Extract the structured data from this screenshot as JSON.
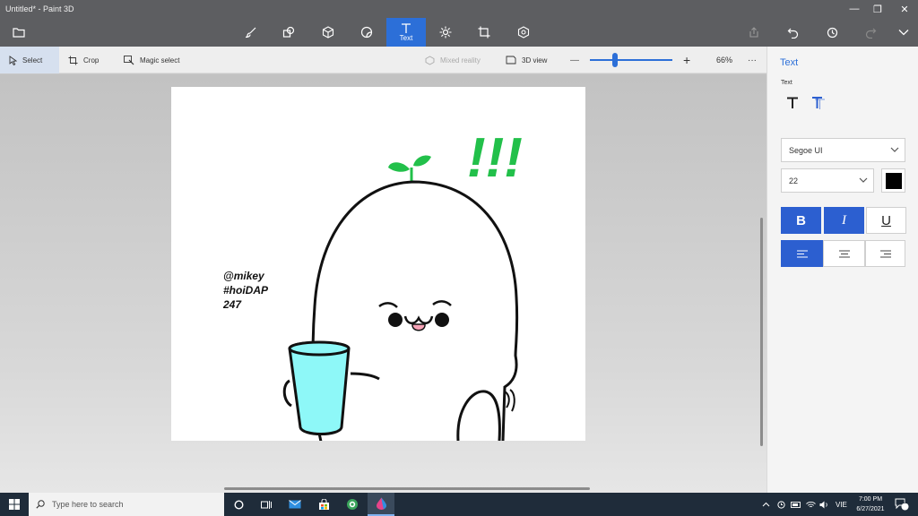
{
  "window": {
    "title": "Untitled* - Paint 3D",
    "minimize_glyph": "—",
    "maximize_glyph": "❐",
    "close_glyph": "✕"
  },
  "toolbar": {
    "tools": [
      {
        "id": "brushes",
        "icon": "brush-icon"
      },
      {
        "id": "2d-shapes",
        "icon": "2d-shapes-icon"
      },
      {
        "id": "3d-shapes",
        "icon": "3d-cube-icon"
      },
      {
        "id": "stickers",
        "icon": "sticker-icon"
      },
      {
        "id": "text",
        "icon": "text-icon",
        "label": "Text",
        "active": true
      },
      {
        "id": "effects",
        "icon": "effects-icon"
      },
      {
        "id": "canvas",
        "icon": "canvas-icon"
      },
      {
        "id": "3d-library",
        "icon": "3d-library-icon"
      }
    ]
  },
  "subbar": {
    "select_label": "Select",
    "crop_label": "Crop",
    "magic_select_label": "Magic select",
    "mixed_reality_label": "Mixed reality",
    "view_3d_label": "3D view",
    "zoom_minus": "—",
    "zoom_plus": "+",
    "zoom_level": "66%",
    "more": "···",
    "zoom_fraction": 0.3
  },
  "canvas": {
    "watermark_line1": "@mikey",
    "watermark_line2": "#hoiDAP",
    "watermark_line3": "247",
    "exclaim": "!!!",
    "sprout_color": "#22c04a",
    "cup_color": "#8ef8f8"
  },
  "panel": {
    "title": "Text",
    "subtitle": "Text",
    "font_name": "Segoe UI",
    "font_size": "22",
    "color": "#000000",
    "bold_label": "B",
    "italic_label": "I",
    "underline_label": "U",
    "accent": "#2c5fd0"
  },
  "taskbar": {
    "search_placeholder": "Type here to search",
    "language": "VIE",
    "time": "7:00 PM",
    "date": "6/27/2021",
    "notification_count": "18"
  }
}
